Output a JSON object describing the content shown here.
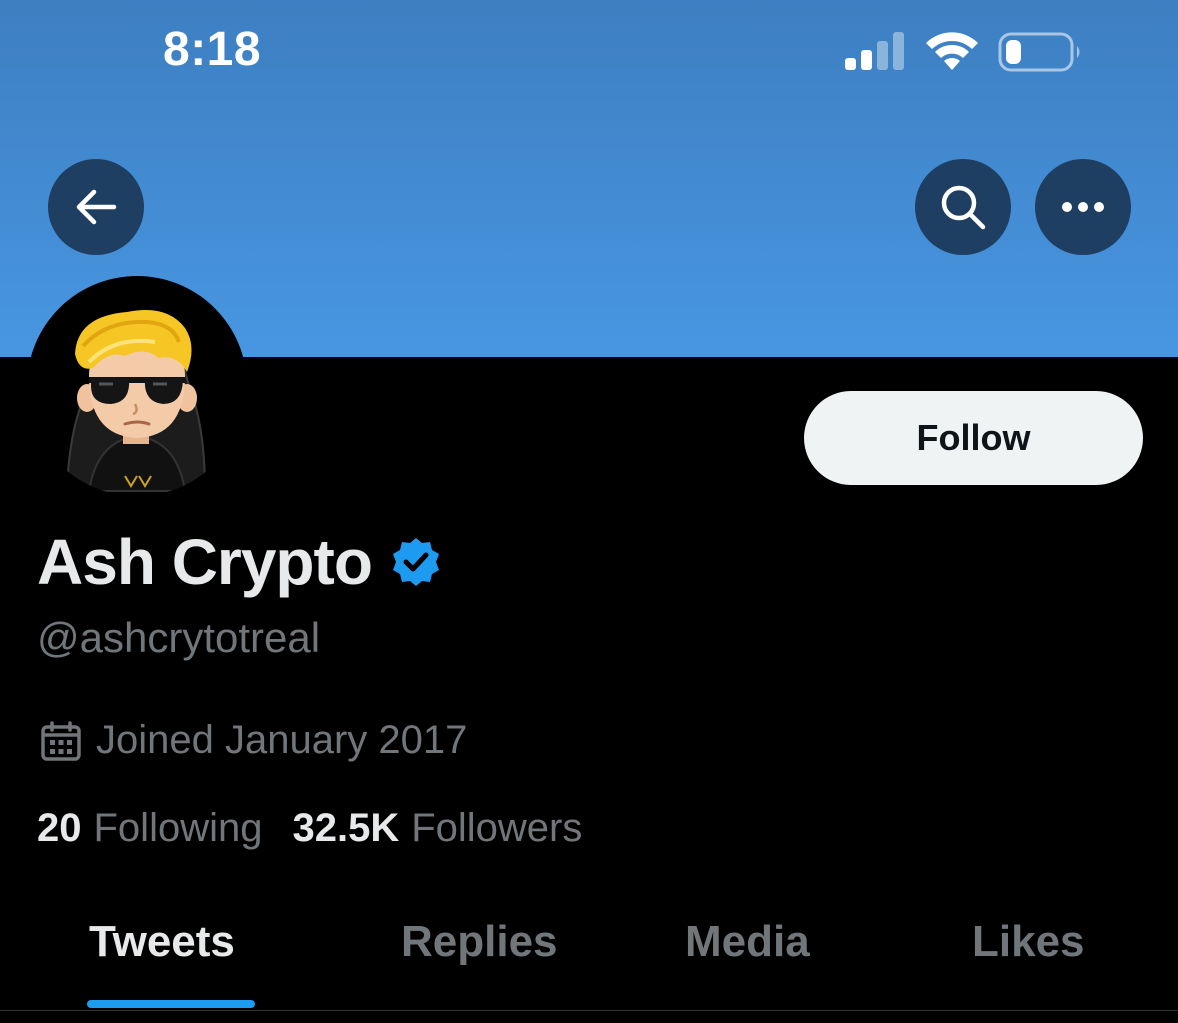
{
  "status_bar": {
    "time": "8:18",
    "signal_icon": "cellular-signal-icon",
    "wifi_icon": "wifi-icon",
    "battery_icon": "battery-icon",
    "battery_level": 0.25
  },
  "header": {
    "back_icon": "back-arrow-icon",
    "search_icon": "search-icon",
    "more_icon": "more-icon",
    "banner_color": "#4896e2"
  },
  "profile": {
    "display_name": "Ash Crypto",
    "verified_icon": "verified-badge-icon",
    "verified_color": "#1d9bf0",
    "handle": "@ashcrytotreal",
    "joined_icon": "calendar-icon",
    "joined": "Joined January 2017",
    "following_count": "20",
    "following_label": "Following",
    "followers_count": "32.5K",
    "followers_label": "Followers",
    "follow_button": "Follow"
  },
  "tabs": [
    {
      "label": "Tweets",
      "active": true
    },
    {
      "label": "Replies",
      "active": false
    },
    {
      "label": "Media",
      "active": false
    },
    {
      "label": "Likes",
      "active": false
    }
  ],
  "colors": {
    "accent": "#1d9bf0",
    "background": "#000000",
    "primary_text": "#e7e9ea",
    "secondary_text": "#71767b"
  }
}
